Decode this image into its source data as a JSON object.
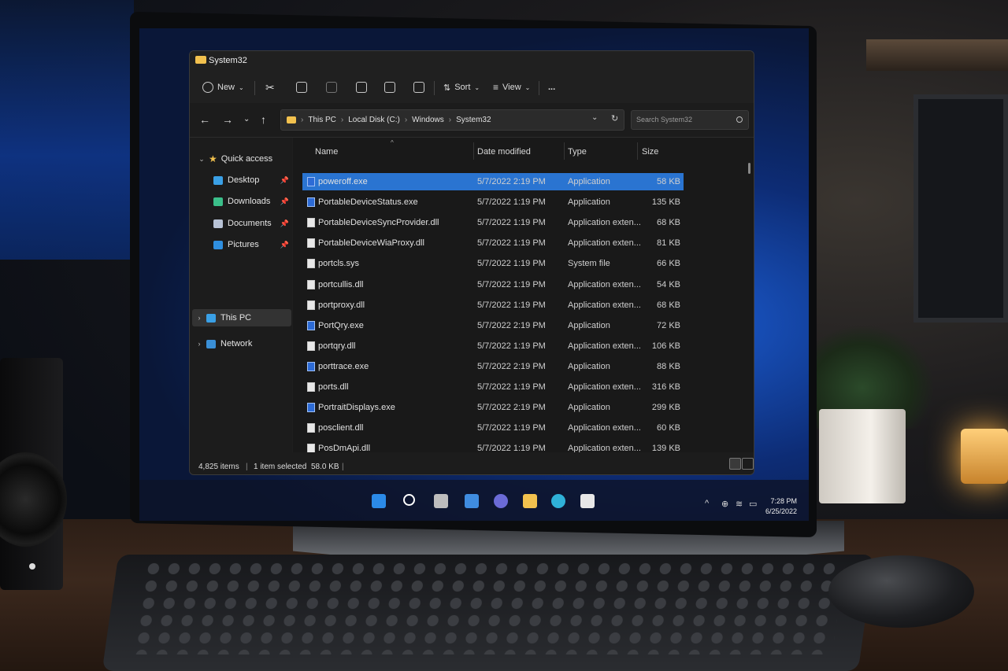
{
  "window": {
    "title": "System32",
    "controls": {
      "minimize": "–",
      "maximize": "☐",
      "close": "✕"
    }
  },
  "toolbar": {
    "new_label": "New",
    "sort_label": "Sort",
    "view_label": "View",
    "more_label": "..."
  },
  "address": {
    "crumbs": [
      "This PC",
      "Local Disk (C:)",
      "Windows",
      "System32"
    ],
    "search_placeholder": "Search System32"
  },
  "nav_pane": {
    "quick_access": "Quick access",
    "items": [
      {
        "label": "Desktop",
        "icon": "desktop-icon",
        "color": "#3aa0e6"
      },
      {
        "label": "Downloads",
        "icon": "downloads-icon",
        "color": "#3bbf8a"
      },
      {
        "label": "Documents",
        "icon": "documents-icon",
        "color": "#b8c3d6"
      },
      {
        "label": "Pictures",
        "icon": "pictures-icon",
        "color": "#2f8fe0"
      }
    ],
    "this_pc": "This PC",
    "network": "Network"
  },
  "columns": {
    "name": "Name",
    "date": "Date modified",
    "type": "Type",
    "size": "Size"
  },
  "files": [
    {
      "name": "poweroff.exe",
      "date": "5/7/2022 2:19 PM",
      "type": "Application",
      "size": "58 KB",
      "kind": "exe",
      "selected": true
    },
    {
      "name": "PortableDeviceStatus.exe",
      "date": "5/7/2022 1:19 PM",
      "type": "Application",
      "size": "135 KB",
      "kind": "exe"
    },
    {
      "name": "PortableDeviceSyncProvider.dll",
      "date": "5/7/2022 1:19 PM",
      "type": "Application exten...",
      "size": "68 KB",
      "kind": "dll"
    },
    {
      "name": "PortableDeviceWiaProxy.dll",
      "date": "5/7/2022 1:19 PM",
      "type": "Application exten...",
      "size": "81 KB",
      "kind": "dll"
    },
    {
      "name": "portcls.sys",
      "date": "5/7/2022 1:19 PM",
      "type": "System file",
      "size": "66 KB",
      "kind": "dll"
    },
    {
      "name": "portcullis.dll",
      "date": "5/7/2022 1:19 PM",
      "type": "Application exten...",
      "size": "54 KB",
      "kind": "dll"
    },
    {
      "name": "portproxy.dll",
      "date": "5/7/2022 1:19 PM",
      "type": "Application exten...",
      "size": "68 KB",
      "kind": "dll"
    },
    {
      "name": "PortQry.exe",
      "date": "5/7/2022 2:19 PM",
      "type": "Application",
      "size": "72 KB",
      "kind": "exe"
    },
    {
      "name": "portqry.dll",
      "date": "5/7/2022 1:19 PM",
      "type": "Application exten...",
      "size": "106 KB",
      "kind": "dll"
    },
    {
      "name": "porttrace.exe",
      "date": "5/7/2022 2:19 PM",
      "type": "Application",
      "size": "88 KB",
      "kind": "exe"
    },
    {
      "name": "ports.dll",
      "date": "5/7/2022 1:19 PM",
      "type": "Application exten...",
      "size": "316 KB",
      "kind": "dll"
    },
    {
      "name": "PortraitDisplays.exe",
      "date": "5/7/2022 2:19 PM",
      "type": "Application",
      "size": "299 KB",
      "kind": "exe"
    },
    {
      "name": "posclient.dll",
      "date": "5/7/2022 1:19 PM",
      "type": "Application exten...",
      "size": "60 KB",
      "kind": "dll"
    },
    {
      "name": "PosDmApi.dll",
      "date": "5/7/2022 1:19 PM",
      "type": "Application exten...",
      "size": "139 KB",
      "kind": "dll"
    }
  ],
  "status": {
    "items": "4,825 items",
    "selected": "1 item selected",
    "size": "58.0 KB"
  },
  "taskbar": {
    "apps": [
      {
        "name": "start-icon",
        "color": "#2b8ae8"
      },
      {
        "name": "search-icon",
        "color": "#ffffff"
      },
      {
        "name": "task-view-icon",
        "color": "#cfcfcf"
      },
      {
        "name": "widgets-icon",
        "color": "#3f8ce0"
      },
      {
        "name": "chat-icon",
        "color": "#6b6bd6"
      },
      {
        "name": "file-explorer-icon",
        "color": "#f2c14e"
      },
      {
        "name": "edge-icon",
        "color": "#2fb1d8"
      },
      {
        "name": "store-icon",
        "color": "#e7e7e7"
      }
    ],
    "time": "7:28 PM",
    "date": "6/25/2022"
  }
}
